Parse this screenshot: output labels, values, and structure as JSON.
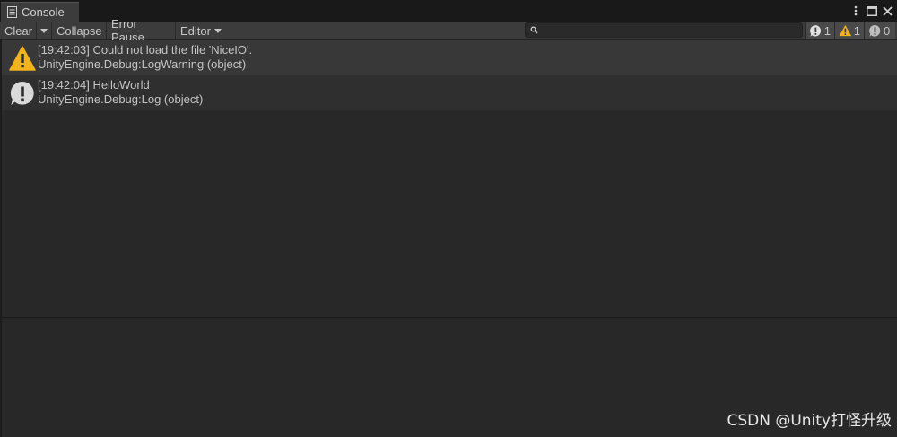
{
  "tab": {
    "title": "Console",
    "icon": "console-icon"
  },
  "window_controls": {
    "menu_icon": "kebab-menu-icon",
    "maximize_icon": "maximize-icon",
    "close_icon": "close-icon"
  },
  "toolbar": {
    "clear_label": "Clear",
    "collapse_label": "Collapse",
    "error_pause_label": "Error Pause",
    "editor_label": "Editor"
  },
  "search": {
    "value": "",
    "placeholder": ""
  },
  "counters": {
    "log_count": "1",
    "warning_count": "1",
    "error_count": "0"
  },
  "logs": [
    {
      "type": "warning",
      "message": "[19:42:03] Could not load the file 'NiceIO'.",
      "source": "UnityEngine.Debug:LogWarning (object)"
    },
    {
      "type": "log",
      "message": "[19:42:04] HelloWorld",
      "source": "UnityEngine.Debug:Log (object)"
    }
  ],
  "watermark": "CSDN @Unity打怪升级",
  "colors": {
    "warning": "#f2b41c",
    "log_icon": "#d9d9d9",
    "background": "#282828",
    "toolbar": "#3c3c3c"
  }
}
